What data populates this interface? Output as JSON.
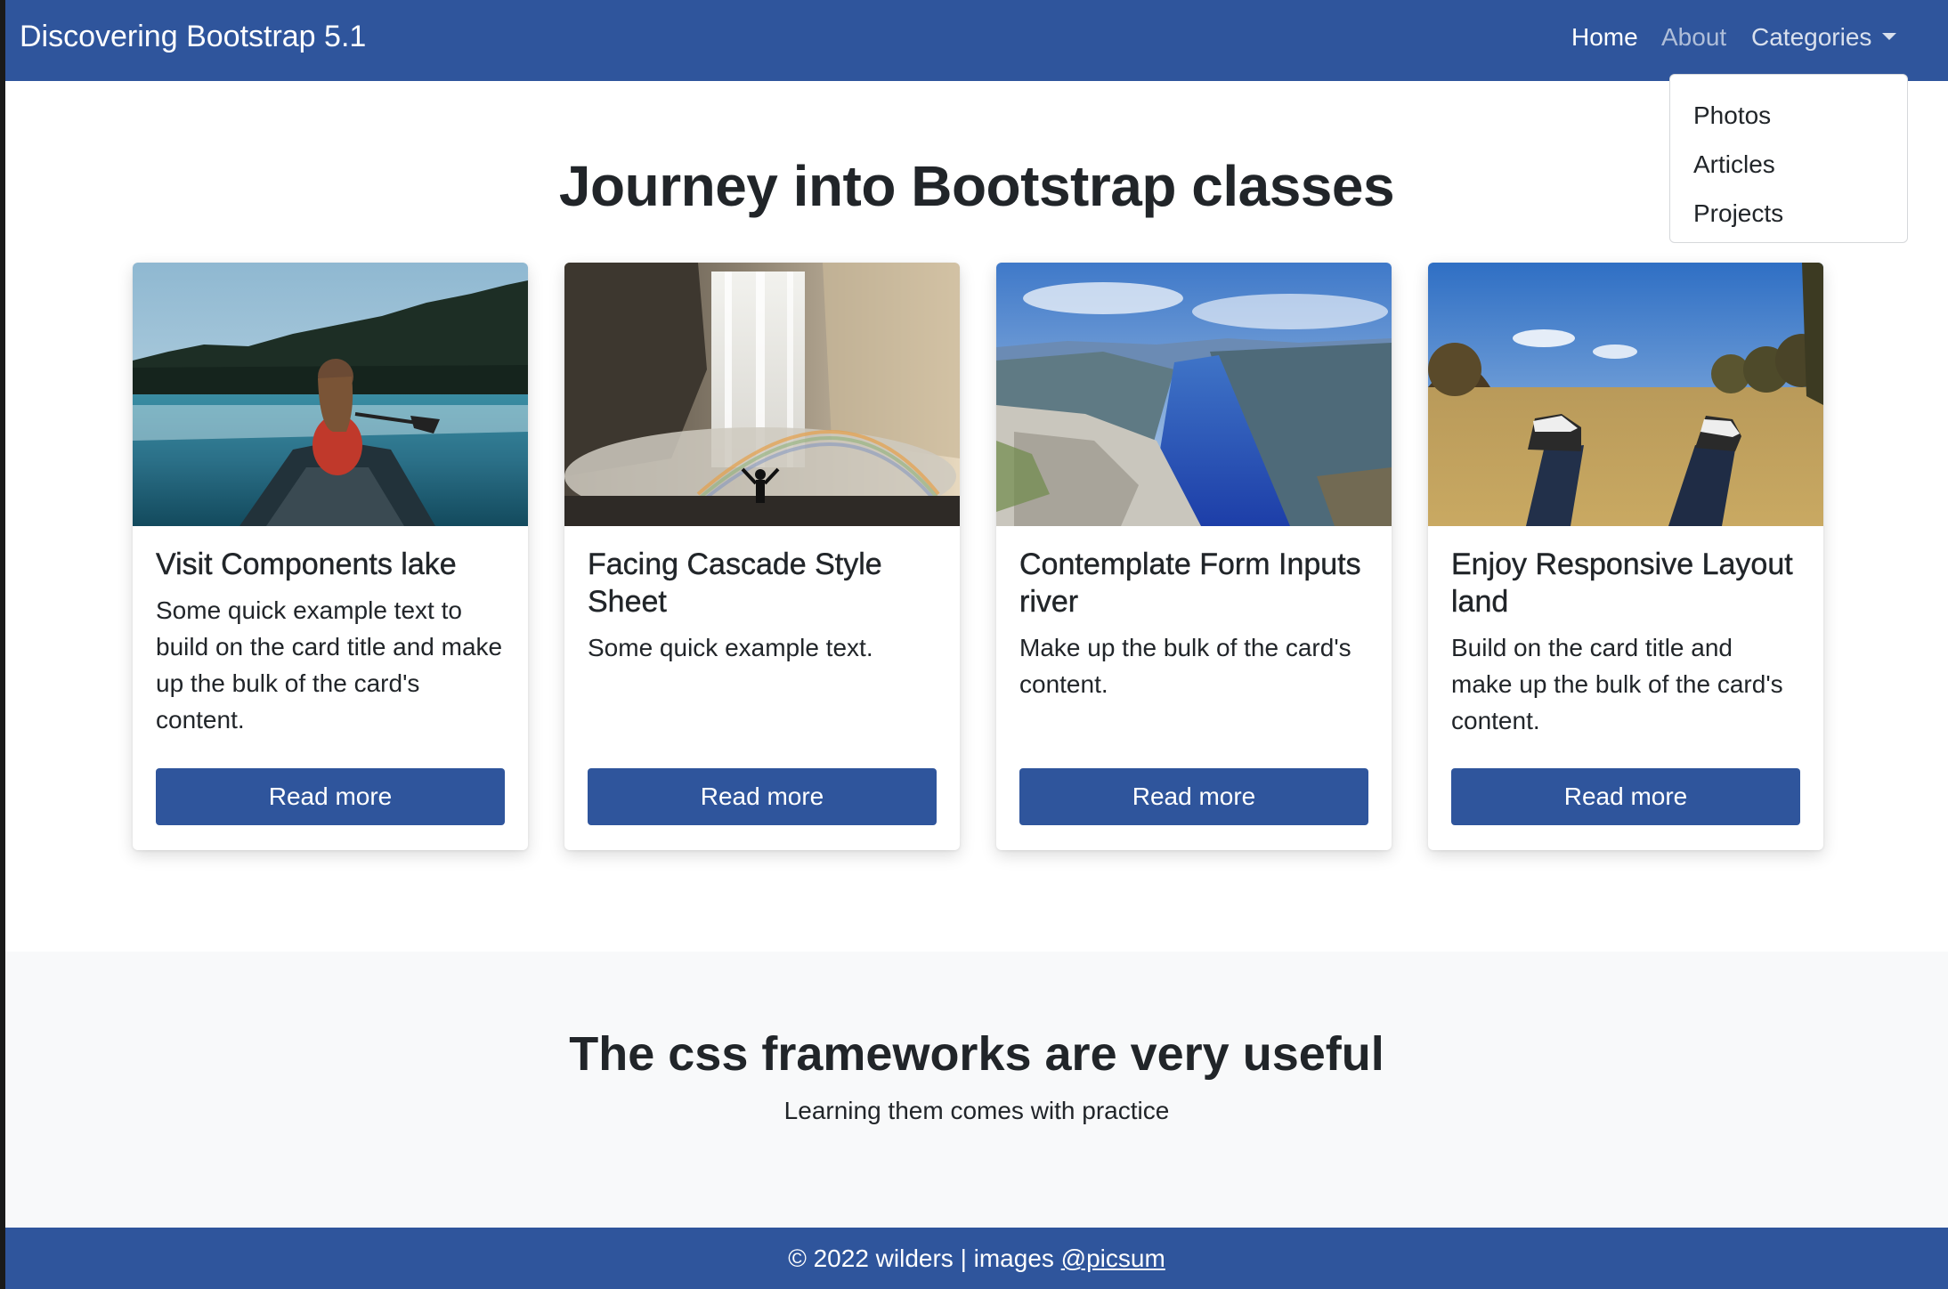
{
  "navbar": {
    "brand": "Discovering Bootstrap 5.1",
    "links": {
      "home": "Home",
      "about": "About",
      "categories": "Categories"
    },
    "dropdown": {
      "items": [
        "Photos",
        "Articles",
        "Projects"
      ]
    },
    "color": "#2f559c"
  },
  "main": {
    "title": "Journey into Bootstrap classes",
    "cards": [
      {
        "title": "Visit Components lake",
        "text": "Some quick example text to build on the card title and make up the bulk of the card's content.",
        "button": "Read more",
        "image": "lake-canoe-photo"
      },
      {
        "title": "Facing Cascade Style Sheet",
        "text": "Some quick example text.",
        "button": "Read more",
        "image": "waterfall-rainbow-photo"
      },
      {
        "title": "Contemplate Form Inputs river",
        "text": "Make up the bulk of the card's content.",
        "button": "Read more",
        "image": "fjord-river-photo"
      },
      {
        "title": "Enjoy Responsive Layout land",
        "text": "Build on the card title and make up the bulk of the card's content.",
        "button": "Read more",
        "image": "field-sneakers-photo"
      }
    ]
  },
  "section": {
    "title": "The css frameworks are very useful",
    "subtitle": "Learning them comes with practice"
  },
  "footer": {
    "text": "© 2022 wilders | images ",
    "link": "@picsum"
  }
}
